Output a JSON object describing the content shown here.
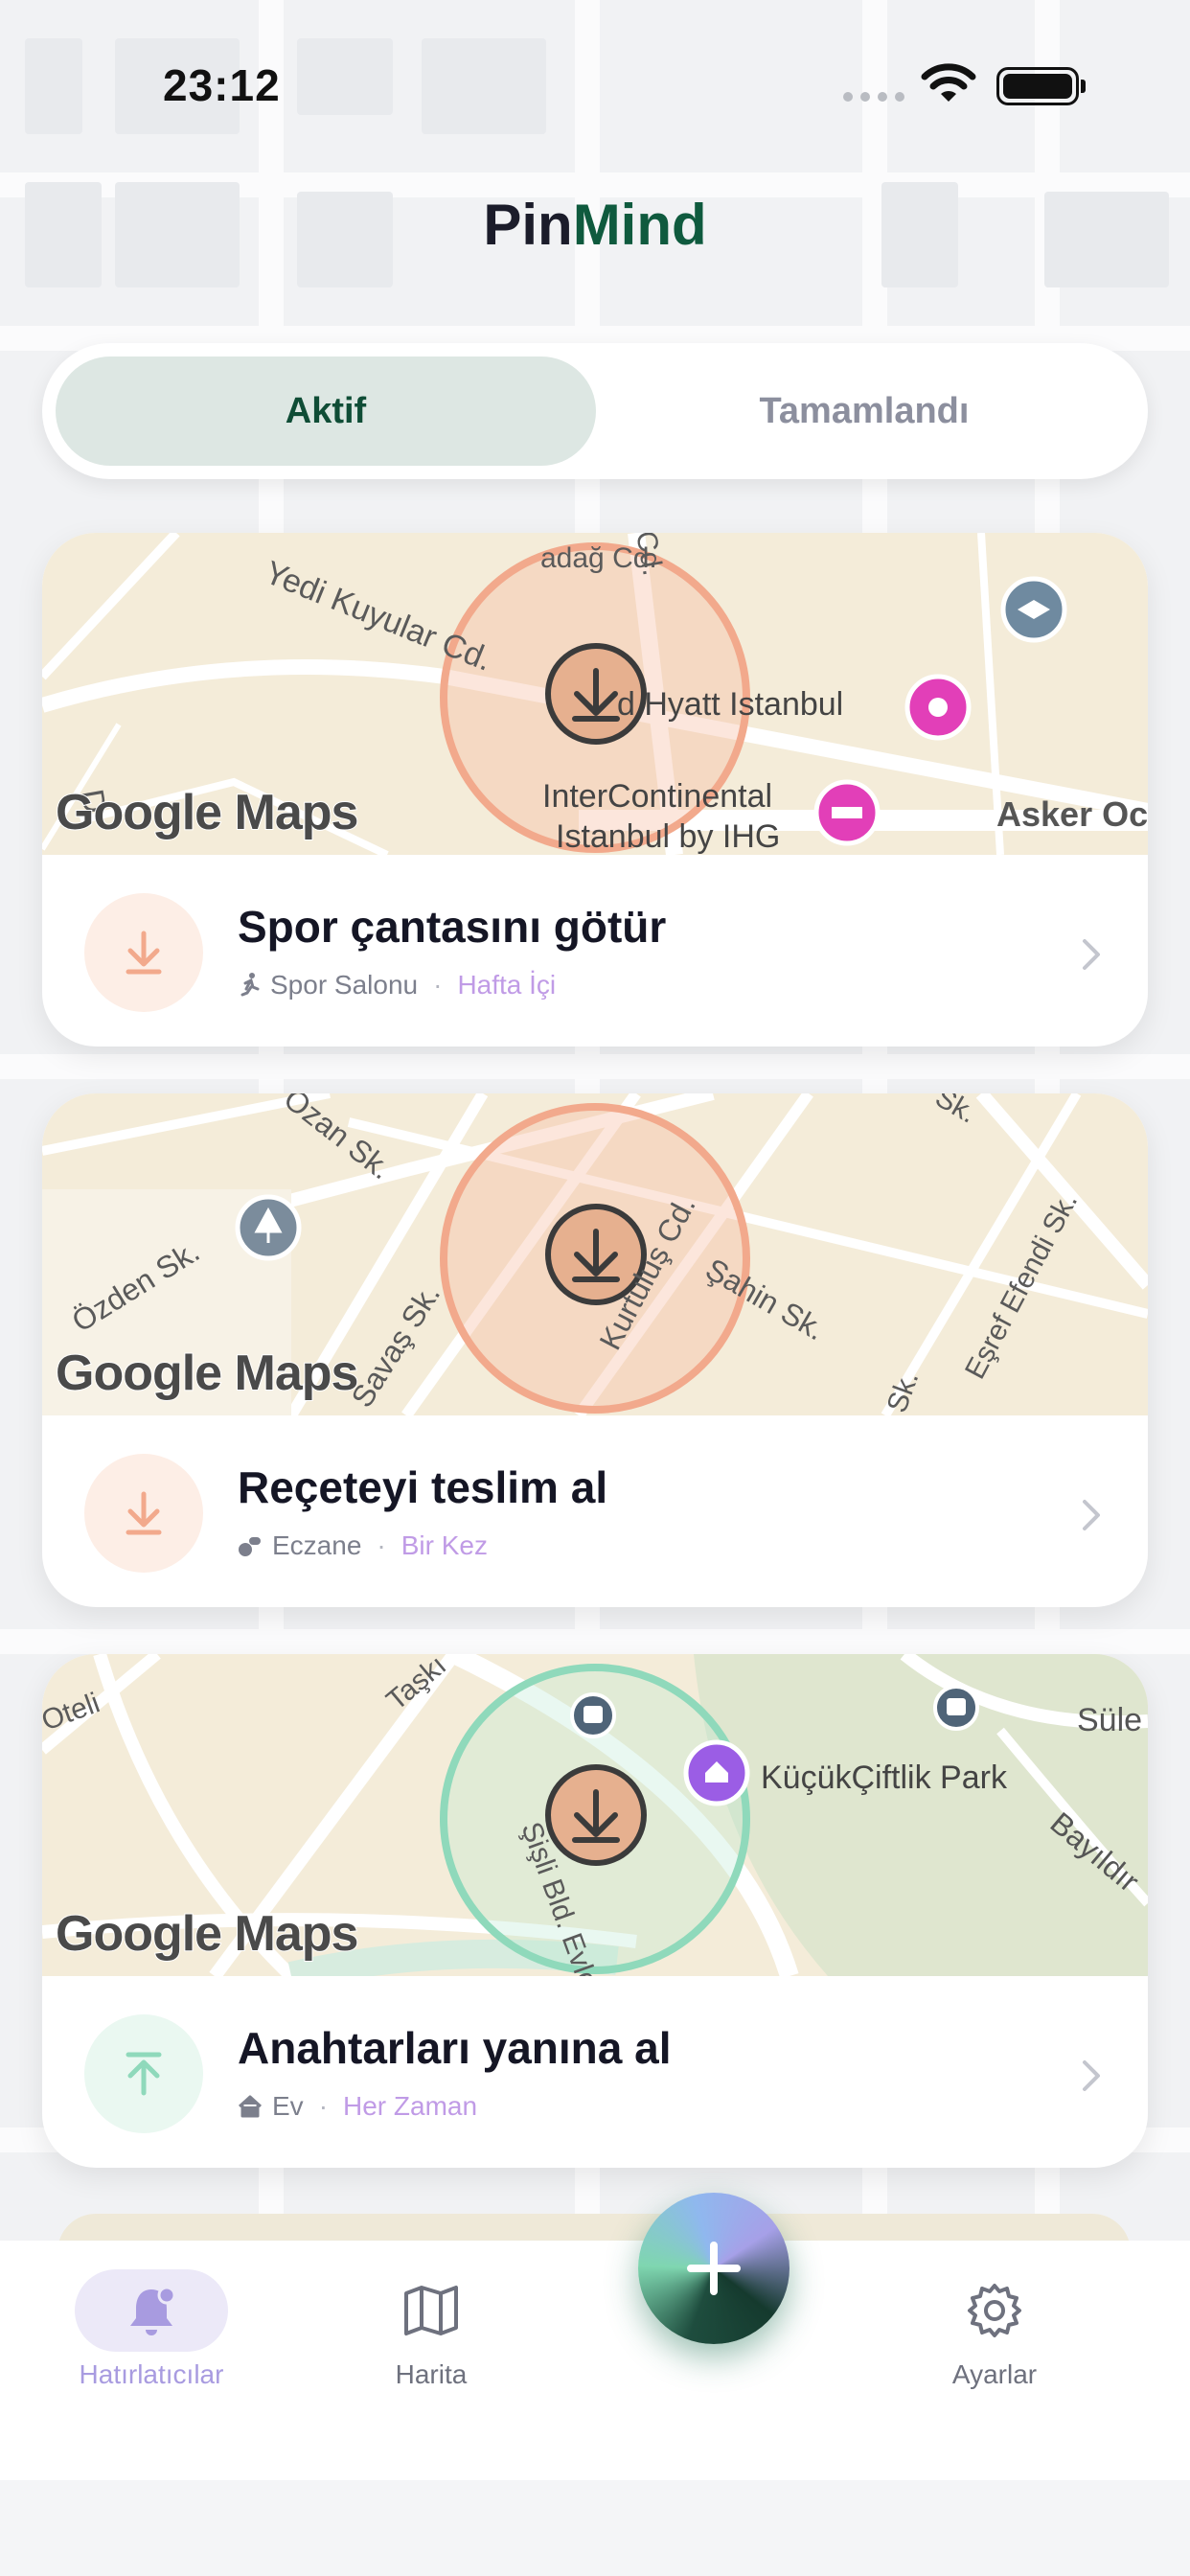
{
  "status_bar": {
    "time": "23:12"
  },
  "brand": {
    "part1": "Pin",
    "part2": "Mind"
  },
  "segments": {
    "active": "Aktif",
    "completed": "Tamamlandı"
  },
  "map_attribution": "Google Maps",
  "cards": [
    {
      "title": "Spor çantasını götür",
      "location": "Spor Salonu",
      "frequency": "Hafta İçi",
      "trigger": "arrive",
      "map_labels": {
        "street1": "Yedi Kuyular Cd.",
        "street2": "adağ Cd.",
        "street3": "Cd.",
        "poi1": "d Hyatt Istanbul",
        "poi2a": "InterContinental",
        "poi2b": "Istanbul by IHG",
        "street4": "Asker Oc",
        "street5": "D"
      }
    },
    {
      "title": "Reçeteyi teslim al",
      "location": "Eczane",
      "frequency": "Bir Kez",
      "trigger": "arrive",
      "map_labels": {
        "street1": "Ozan Sk.",
        "street2": "Özden Sk.",
        "street3": "Savaş Sk.",
        "street4": "Kurtuluş Cd.",
        "street5": "Şahin Sk.",
        "street6": "Eşref Efendi Sk.",
        "street7": "Sk.",
        "street8": "Sk."
      }
    },
    {
      "title": "Anahtarları yanına al",
      "location": "Ev",
      "frequency": "Her Zaman",
      "trigger": "leave",
      "map_labels": {
        "street1": "Oteli",
        "street2": "Taşkı",
        "poi1": "KüçükÇiftlik Park",
        "street3": "Şişli Bld. Evle",
        "street4": "Süle",
        "street5": "Bayıldır"
      }
    }
  ],
  "nav": {
    "reminders": "Hatırlatıcılar",
    "map": "Harita",
    "settings": "Ayarlar"
  },
  "colors": {
    "accent_green": "#0f5a3e",
    "arrive_orange": "#f2a98c",
    "leave_green": "#8fd9bb",
    "frequency_purple": "#c09be6",
    "nav_active": "#a89be0"
  }
}
